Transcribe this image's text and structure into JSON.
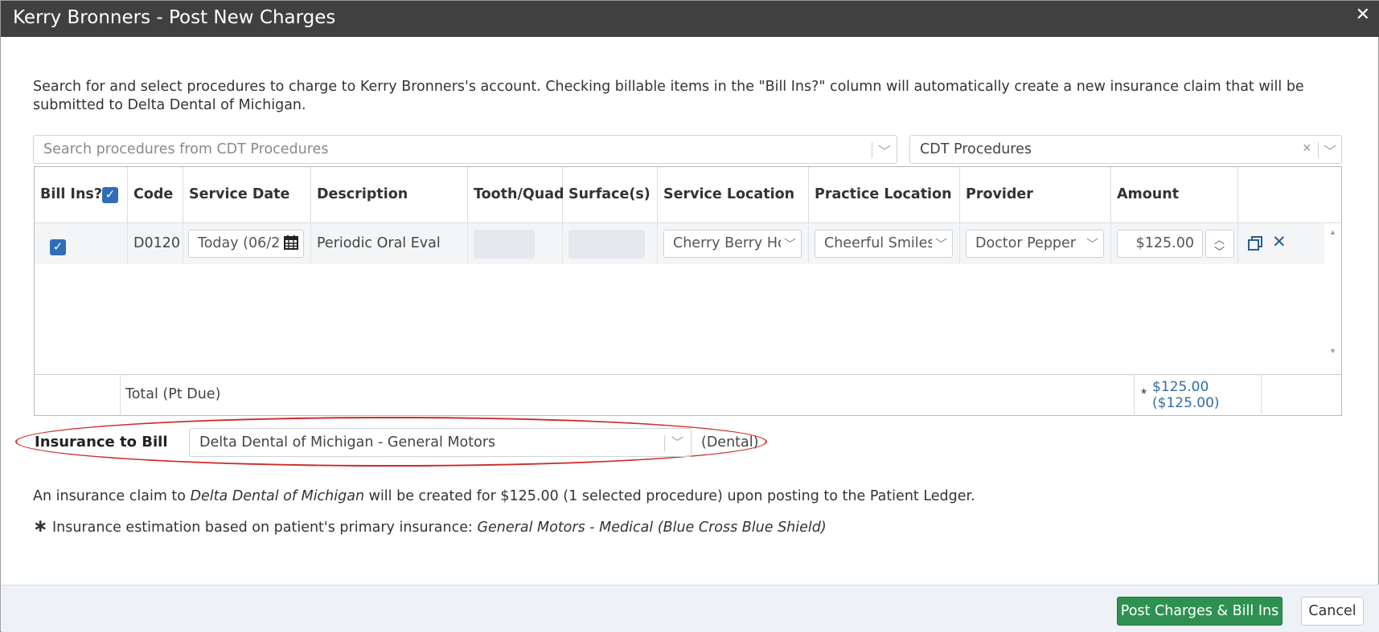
{
  "window": {
    "title": "Kerry Bronners - Post New Charges",
    "close_glyph": "✕"
  },
  "intro_text": "Search for and select procedures to charge to Kerry Bronners's account. Checking billable items in the \"Bill Ins?\" column will automatically create a new insurance claim that will be submitted to Delta Dental of Michigan.",
  "search": {
    "placeholder": "Search procedures from CDT Procedures",
    "source_value": "CDT Procedures"
  },
  "table": {
    "headers": [
      "Bill Ins?",
      "Code",
      "Service Date",
      "Description",
      "Tooth/Quad",
      "Surface(s)",
      "Service Location",
      "Practice Location",
      "Provider",
      "Amount"
    ],
    "rows": [
      {
        "bill_ins": true,
        "code": "D0120",
        "service_date": "Today (06/2",
        "description": "Periodic Oral Eval",
        "tooth_quad": "",
        "surfaces": "",
        "service_location": "Cherry Berry Ho",
        "practice_location": "Cheerful Smiles",
        "provider": "Doctor Pepper",
        "amount": "$125.00"
      }
    ],
    "footer": {
      "label": "Total (Pt Due)",
      "asterisk": "*",
      "total": "$125.00",
      "pt_due": "($125.00)"
    }
  },
  "insurance": {
    "label": "Insurance to Bill",
    "selected": "Delta Dental of Michigan - General Motors",
    "type": "(Dental)"
  },
  "notes": {
    "line1_a": "An insurance claim to ",
    "line1_ins": "Delta Dental of Michigan",
    "line1_b": "  will be created for $125.00  (1 selected procedure) upon posting to the Patient Ledger.",
    "line2_ast": "∗",
    "line2_a": " Insurance estimation based on patient's primary insurance: ",
    "line2_ins": "General Motors - Medical (Blue Cross Blue Shield)"
  },
  "buttons": {
    "post": "Post Charges & Bill Ins",
    "cancel": "Cancel"
  },
  "colors": {
    "titlebar": "#404040",
    "primary_green": "#2e9152",
    "checkbox_blue": "#2f6eb5",
    "link_blue": "#2c6ea8",
    "highlight_red": "#cc2b2b"
  }
}
